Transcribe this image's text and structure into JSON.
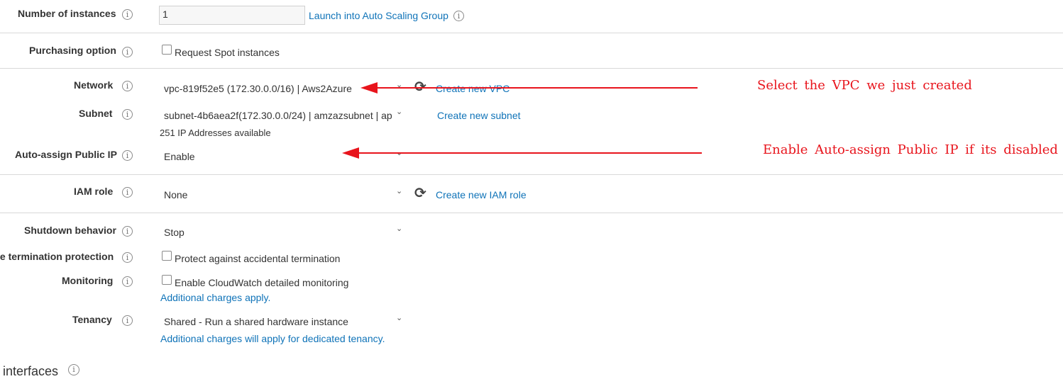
{
  "rows": {
    "instances": {
      "label": "Number of instances",
      "value": "1",
      "link": "Launch into Auto Scaling Group"
    },
    "purchasing": {
      "label": "Purchasing option",
      "checkbox": "Request Spot instances"
    },
    "network": {
      "label": "Network",
      "value": "vpc-819f52e5 (172.30.0.0/16) | Aws2Azure",
      "link": "Create new VPC"
    },
    "subnet": {
      "label": "Subnet",
      "value": "subnet-4b6aea2f(172.30.0.0/24) | amzazsubnet | ap",
      "link": "Create new subnet",
      "note": "251 IP Addresses available"
    },
    "public_ip": {
      "label": "Auto-assign Public IP",
      "value": "Enable"
    },
    "iam": {
      "label": "IAM role",
      "value": "None",
      "link": "Create new IAM role"
    },
    "shutdown": {
      "label": "Shutdown behavior",
      "value": "Stop"
    },
    "termination": {
      "label": "le termination protection",
      "checkbox": "Protect against accidental termination"
    },
    "monitoring": {
      "label": "Monitoring",
      "checkbox": "Enable CloudWatch detailed monitoring",
      "note": "Additional charges apply."
    },
    "tenancy": {
      "label": "Tenancy",
      "value": "Shared - Run a shared hardware instance",
      "note": "Additional charges will apply for dedicated tenancy."
    }
  },
  "section_partial": "interfaces",
  "annotations": {
    "vpc": "Select the VPC we just created",
    "public_ip": "Enable Auto-assign Public IP if its disabled"
  },
  "colors": {
    "link": "#0f73b8",
    "annotation": "#e8141c",
    "divider": "#d9d9d9"
  },
  "icons": {
    "info": "i",
    "refresh": "⟳",
    "chevron": "⌄"
  }
}
